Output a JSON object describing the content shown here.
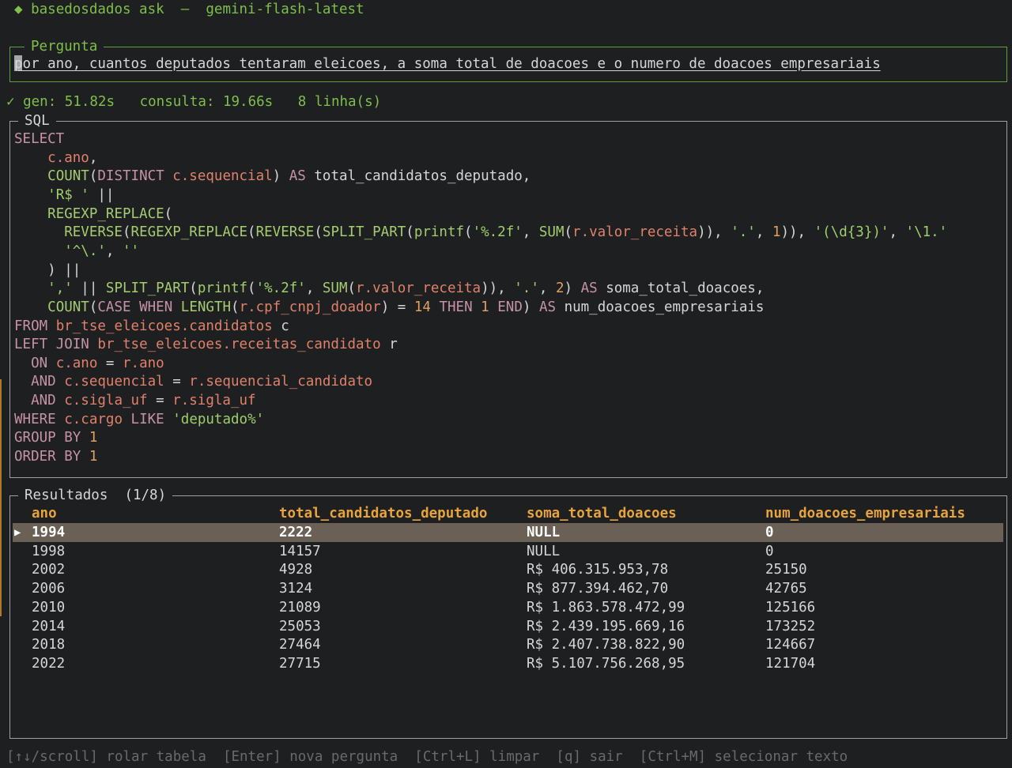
{
  "titlebar": {
    "icon": "diamond-icon",
    "app_name": "basedosdados ask",
    "separator": "—",
    "model": "gemini-flash-latest"
  },
  "question": {
    "label": "Pergunta",
    "value": "por ano, cuantos deputados tentaram eleicoes, a soma total de doacoes e o numero de doacoes empresariais"
  },
  "status": {
    "check": "✓",
    "gen": "gen: 51.82s",
    "consulta": "consulta: 19.66s",
    "rows": "8 linha(s)"
  },
  "sql": {
    "label": "SQL",
    "lines": [
      "SELECT",
      "    c.ano,",
      "    COUNT(DISTINCT c.sequencial) AS total_candidatos_deputado,",
      "    'R$ ' ||",
      "    REGEXP_REPLACE(",
      "      REVERSE(REGEXP_REPLACE(REVERSE(SPLIT_PART(printf('%.2f', SUM(r.valor_receita)), '.', 1)), '(\\d{3})', '\\1.'",
      "      '^\\.', ''",
      "    ) ||",
      "    ',' || SPLIT_PART(printf('%.2f', SUM(r.valor_receita)), '.', 2) AS soma_total_doacoes,",
      "    COUNT(CASE WHEN LENGTH(r.cpf_cnpj_doador) = 14 THEN 1 END) AS num_doacoes_empresariais",
      "FROM br_tse_eleicoes.candidatos c",
      "LEFT JOIN br_tse_eleicoes.receitas_candidato r",
      "  ON c.ano = r.ano",
      "  AND c.sequencial = r.sequencial_candidato",
      "  AND c.sigla_uf = r.sigla_uf",
      "WHERE c.cargo LIKE 'deputado%'",
      "GROUP BY 1",
      "ORDER BY 1"
    ]
  },
  "results": {
    "label": "Resultados",
    "page": "(1/8)",
    "selected_marker": "▶",
    "columns": [
      "ano",
      "total_candidatos_deputado",
      "soma_total_doacoes",
      "num_doacoes_empresariais"
    ],
    "rows": [
      [
        "1994",
        "2222",
        "NULL",
        "0"
      ],
      [
        "1998",
        "14157",
        "NULL",
        "0"
      ],
      [
        "2002",
        "4928",
        "R$ 406.315.953,78",
        "25150"
      ],
      [
        "2006",
        "3124",
        "R$ 877.394.462,70",
        "42765"
      ],
      [
        "2010",
        "21089",
        "R$ 1.863.578.472,99",
        "125166"
      ],
      [
        "2014",
        "25053",
        "R$ 2.439.195.669,16",
        "173252"
      ],
      [
        "2018",
        "27464",
        "R$ 2.407.738.822,90",
        "124667"
      ],
      [
        "2022",
        "27715",
        "R$ 5.107.756.268,95",
        "121704"
      ]
    ]
  },
  "footer": {
    "scroll": "[↑↓/scroll] rolar tabela",
    "enter": "[Enter] nova pergunta",
    "clear": "[Ctrl+L] limpar",
    "quit": "[q] sair",
    "select": "[Ctrl+M] selecionar texto"
  }
}
